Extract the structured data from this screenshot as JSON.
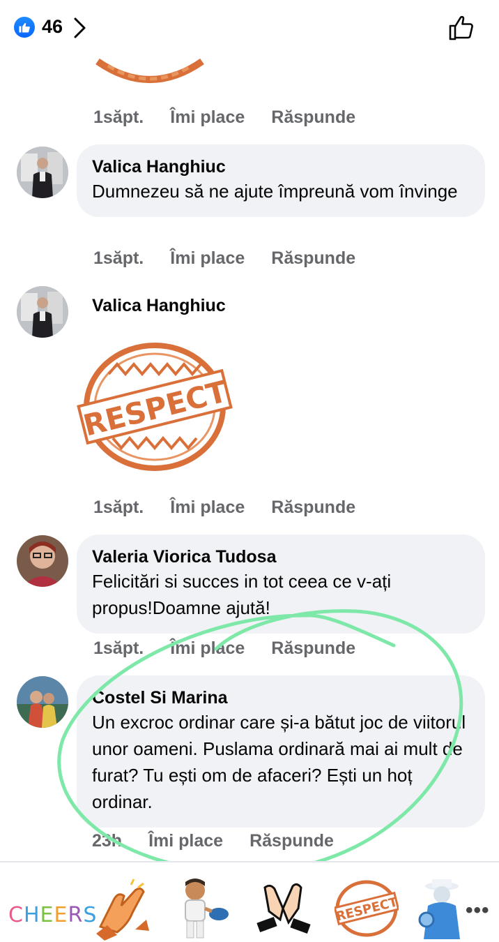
{
  "header": {
    "reaction_count": "46",
    "like_icon": "thumbs-up-icon",
    "chevron_icon": "chevron-right-icon",
    "like_button_icon": "thumbs-up-outline-icon"
  },
  "comments": [
    {
      "time": "1săpt.",
      "like_label": "Îmi place",
      "reply_label": "Răspunde"
    },
    {
      "author": "Valica Hanghiuc",
      "text": "Dumnezeu să ne ajute împreună vom învinge",
      "time": "1săpt.",
      "like_label": "Îmi place",
      "reply_label": "Răspunde"
    },
    {
      "author": "Valica Hanghiuc",
      "sticker": "RESPECT",
      "time": "1săpt.",
      "like_label": "Îmi place",
      "reply_label": "Răspunde"
    },
    {
      "author": "Valeria Viorica Tudosa",
      "text": "Felicitări si succes in tot ceea ce v-ați propus!Doamne ajută!",
      "time": "1săpt.",
      "like_label": "Îmi place",
      "reply_label": "Răspunde"
    },
    {
      "author": "Costel Si Marina",
      "text": "Un excroc ordinar care și-a bătut joc de viitorul unor oameni. Puslama ordinară mai ai mult de furat? Tu ești om de afaceri? Ești un hoț ordinar.",
      "time": "23h",
      "like_label": "Îmi place",
      "reply_label": "Răspunde"
    }
  ],
  "sticker_bar": {
    "cheers": "CHEERS",
    "respect": "RESPECT",
    "more": "•••",
    "items": [
      "cheers-sticker",
      "clapping-hands-sticker",
      "cook-character-sticker",
      "clapping-outline-sticker",
      "respect-stamp-sticker",
      "detective-character-sticker"
    ]
  },
  "colors": {
    "accent": "#0866ff",
    "bubble": "#f0f2f5",
    "meta_text": "#65676b",
    "annotation": "#7ee8a8",
    "respect_orange": "#d9703a"
  }
}
